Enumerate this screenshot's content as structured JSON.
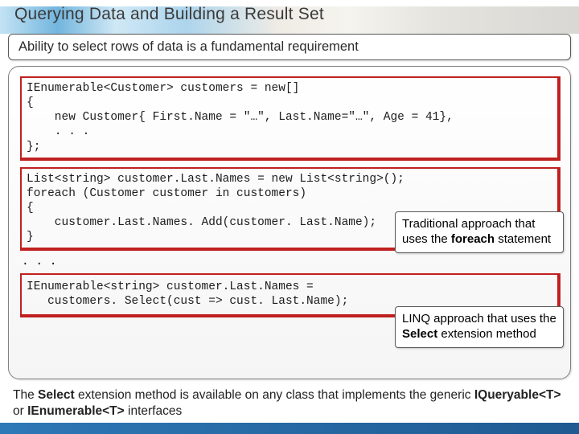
{
  "title": "Querying Data and Building a Result Set",
  "subtitle": "Ability to select rows of data is a fundamental requirement",
  "code": {
    "block1": "IEnumerable<Customer> customers = new[]\n{\n    new Customer{ First.Name = \"…\", Last.Name=\"…\", Age = 41},\n    . . .\n};",
    "block2": "List<string> customer.Last.Names = new List<string>();\nforeach (Customer customer in customers)\n{\n    customer.Last.Names. Add(customer. Last.Name);\n}",
    "ellipsis": ". . .",
    "block3": "IEnumerable<string> customer.Last.Names =\n   customers. Select(cust => cust. Last.Name);"
  },
  "notes": {
    "n1_pre": "Traditional approach that uses the ",
    "n1_bold": "foreach",
    "n1_post": " statement",
    "n2_pre": "LINQ approach that uses the ",
    "n2_bold": "Select",
    "n2_post": " extension method"
  },
  "footer": {
    "p1": "The ",
    "b1": "Select",
    "p2": " extension method is available on any class that implements the generic ",
    "b2": "IQueryable<T>",
    "p3": " or ",
    "b3": "IEnumerable<T>",
    "p4": " interfaces"
  }
}
